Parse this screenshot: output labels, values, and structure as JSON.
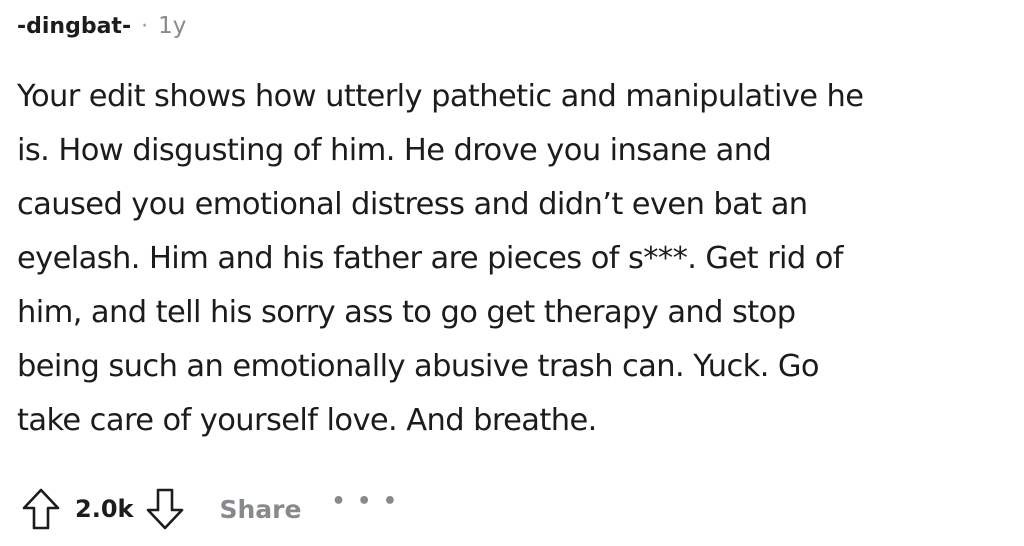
{
  "comment": {
    "author": "-dingbat-",
    "separator": "·",
    "age": "1y",
    "lines": [
      "Your edit shows how utterly pathetic and manipulative he",
      "is. How disgusting of him. He drove you insane and",
      "caused you emotional distress and didn’t even bat an",
      "eyelash. Him and his father are pieces of s***. Get rid of",
      "him, and tell his sorry ass to go get therapy and stop",
      "being such an emotionally abusive trash can. Yuck. Go",
      "take care of yourself love. And breathe."
    ]
  },
  "actions": {
    "upvote_icon": "arrow-up-outline-icon",
    "score": "2.0k",
    "downvote_icon": "arrow-down-outline-icon",
    "share_label": "Share",
    "more_label": "• • •"
  },
  "colors": {
    "text": "#1c1c1c",
    "muted": "#878a8c",
    "background": "#ffffff"
  }
}
